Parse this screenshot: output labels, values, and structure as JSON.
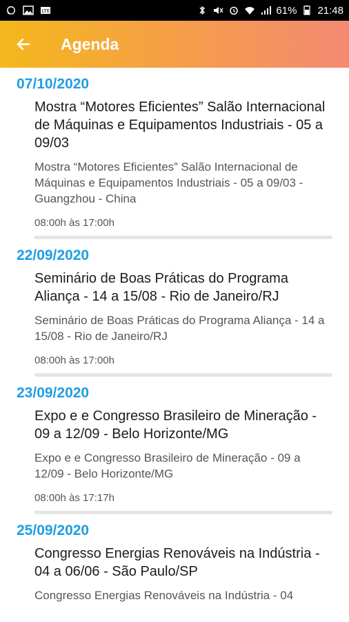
{
  "status_bar": {
    "left_icons": [
      "whatsapp-icon",
      "image-icon",
      "lte-icon"
    ],
    "battery": "61%",
    "time": "21:48"
  },
  "app_bar": {
    "title": "Agenda",
    "back_icon": "arrow-left-icon"
  },
  "events": [
    {
      "date": "07/10/2020",
      "title": "Mostra “Motores Eficientes” Salão Internacional de Máquinas e Equipamentos Industriais - 05 a 09/03",
      "description": "Mostra “Motores Eficientes” Salão Internacional de Máquinas e Equipamentos Industriais - 05 a 09/03 - Guangzhou - China",
      "time": "08:00h às 17:00h"
    },
    {
      "date": "22/09/2020",
      "title": "Seminário de Boas Práticas do Programa Aliança - 14 a 15/08 - Rio de Janeiro/RJ",
      "description": "Seminário de Boas Práticas do Programa Aliança - 14 a 15/08 - Rio de Janeiro/RJ",
      "time": "08:00h às 17:00h"
    },
    {
      "date": "23/09/2020",
      "title": "Expo e e Congresso Brasileiro de Mineração - 09 a 12/09 - Belo Horizonte/MG",
      "description": "Expo e e Congresso Brasileiro de Mineração - 09 a 12/09 - Belo Horizonte/MG",
      "time": "08:00h às 17:17h"
    },
    {
      "date": "25/09/2020",
      "title": "Congresso Energias Renováveis na Indústria - 04 a 06/06 - São Paulo/SP",
      "description": "Congresso Energias Renováveis na Indústria - 04",
      "time": ""
    }
  ],
  "colors": {
    "accent": "#1f9de3",
    "appbar_start": "#f4b81c",
    "appbar_end": "#f48a73"
  }
}
